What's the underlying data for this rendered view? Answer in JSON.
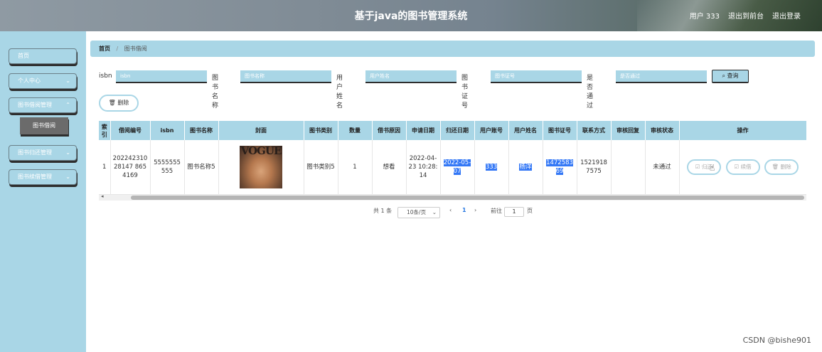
{
  "header": {
    "title": "基于java的图书管理系统",
    "user": "用户 333",
    "back_front": "退出到前台",
    "logout": "退出登录"
  },
  "sidebar": {
    "items": [
      {
        "label": "首页"
      },
      {
        "label": "个人中心"
      },
      {
        "label": "图书借阅管理"
      },
      {
        "label": "图书归还管理"
      },
      {
        "label": "图书续借管理"
      }
    ],
    "sub_active": "图书借阅"
  },
  "breadcrumb": {
    "home": "首页",
    "current": "图书借阅"
  },
  "search": {
    "fields": [
      {
        "label": "isbn",
        "placeholder": "isbn"
      },
      {
        "label": "图书名称",
        "placeholder": "图书名称"
      },
      {
        "label": "用户姓名",
        "placeholder": "用户姓名"
      },
      {
        "label": "图书证号",
        "placeholder": "图书证号"
      },
      {
        "label": "是否通过",
        "placeholder": "是否通过"
      }
    ],
    "button": "查询"
  },
  "delete_button": "删除",
  "table": {
    "headers": [
      "索引",
      "借阅编号",
      "isbn",
      "图书名称",
      "封面",
      "图书类别",
      "数量",
      "借书原因",
      "申请日期",
      "归还日期",
      "用户账号",
      "用户姓名",
      "图书证号",
      "联系方式",
      "审核回复",
      "审核状态",
      "操作"
    ],
    "rows": [
      {
        "index": "1",
        "borrow_no": "20224231028147 8654169",
        "isbn": "5555555555",
        "book_name": "图书名称5",
        "cover_text": "VOGUE",
        "category": "图书类别5",
        "quantity": "1",
        "reason": "想看",
        "apply_date": "2022-04-23 10:28:14",
        "return_date": "2022-05-07",
        "account": "333",
        "user_name": "杨洋",
        "card_no": "147258369",
        "phone": "15219187575",
        "reply": "",
        "status": "未通过",
        "actions": [
          "归还",
          "续借",
          "删除"
        ]
      }
    ]
  },
  "pagination": {
    "total": "共 1 条",
    "page_size": "10条/页",
    "current": "1",
    "goto_label": "前往",
    "goto_value": "1",
    "page_unit": "页"
  },
  "watermark": "CSDN @bishe901"
}
